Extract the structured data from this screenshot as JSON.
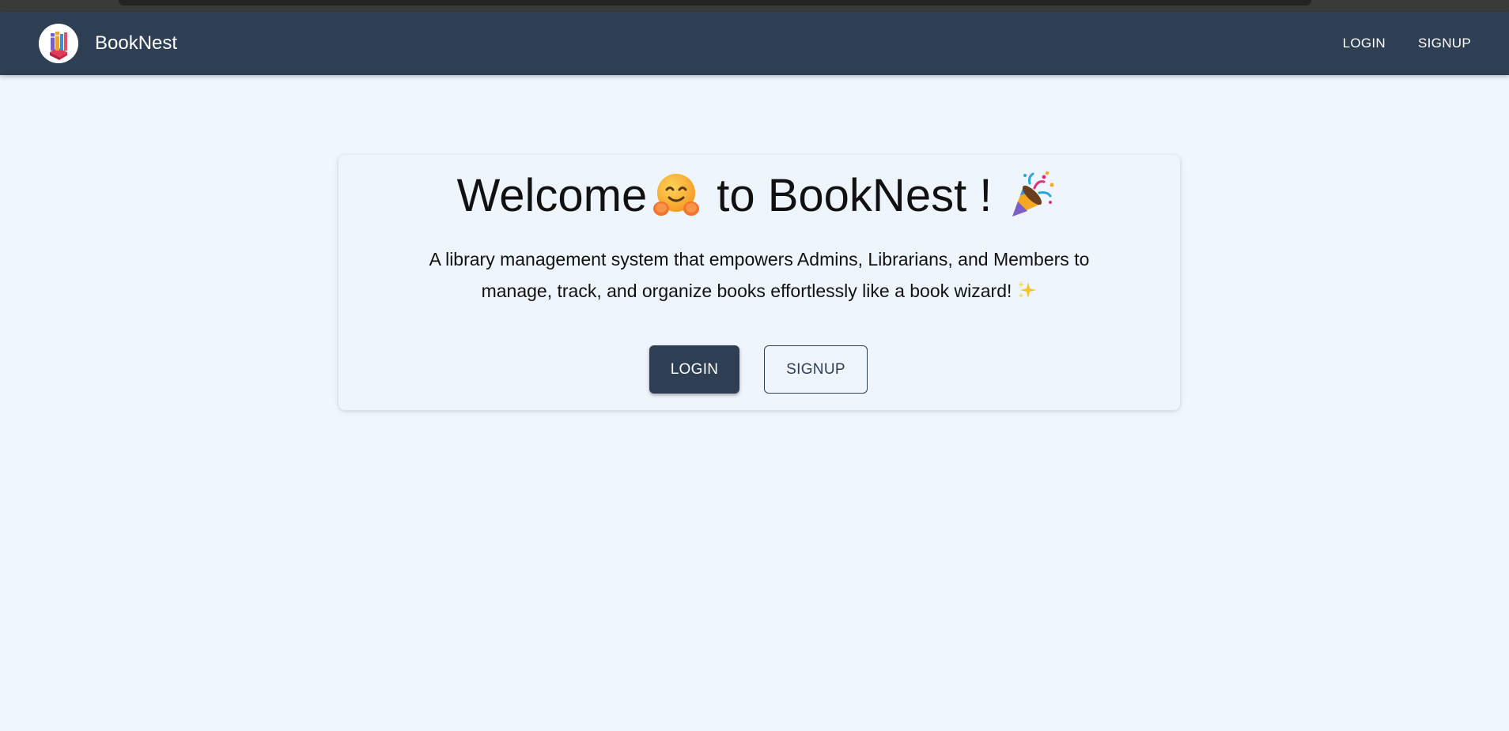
{
  "app": {
    "brand_name": "BookNest",
    "logo_icon": "book-stack-icon"
  },
  "navbar": {
    "links": [
      {
        "label": "LOGIN"
      },
      {
        "label": "SIGNUP"
      }
    ]
  },
  "hero": {
    "title_part1": "Welcome",
    "title_emoji1": "hugging-face-icon",
    "title_part2": "to BookNest !",
    "title_emoji2": "party-popper-icon",
    "description_line1": "A library management system that empowers Admins, Librarians, and Members to",
    "description_line2": "manage, track, and organize books effortlessly like a book wizard!",
    "description_emoji": "sparkles-icon",
    "login_label": "LOGIN",
    "signup_label": "SIGNUP"
  },
  "colors": {
    "navbar_bg": "#2e3e53",
    "page_bg": "#eff6fd",
    "primary_button": "#2e3e53"
  }
}
